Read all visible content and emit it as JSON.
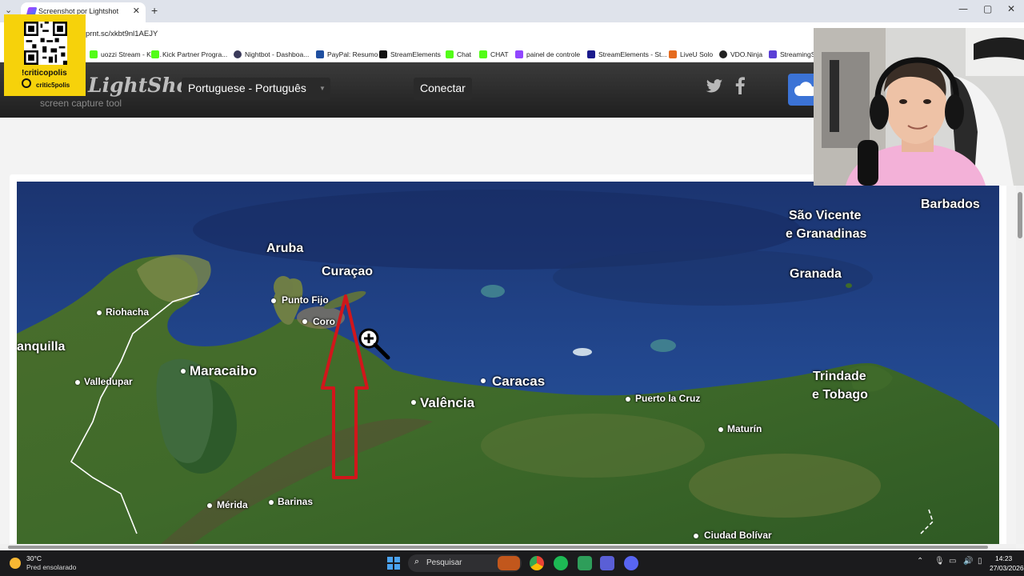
{
  "browser": {
    "tab_title": "Screenshot por Lightshot",
    "url": "prnt.sc/xkbt9nl1AEJY",
    "tab_close": "✕",
    "new_tab": "+",
    "window_controls": [
      "—",
      "▢",
      "✕"
    ],
    "bookmarks": [
      {
        "label": "uozzi Stream - Kic...",
        "icon": "kick-icon",
        "color": "#53fc18"
      },
      {
        "label": "Kick Partner Progra...",
        "icon": "kick-icon",
        "color": "#53fc18"
      },
      {
        "label": "Nightbot - Dashboa...",
        "icon": "nightbot-icon",
        "color": "#3a3a5a"
      },
      {
        "label": "PayPal: Resumo",
        "icon": "paypal-icon",
        "color": "#1f4fa0"
      },
      {
        "label": "StreamElements",
        "icon": "streamelements-icon",
        "color": "#111111"
      },
      {
        "label": "Chat",
        "icon": "kick-icon",
        "color": "#53fc18"
      },
      {
        "label": "CHAT",
        "icon": "kick-icon",
        "color": "#53fc18"
      },
      {
        "label": "painel de controle",
        "icon": "twitch-icon",
        "color": "#9146ff"
      },
      {
        "label": "StreamElements - St...",
        "icon": "streamelements-icon",
        "color": "#1a1a8c"
      },
      {
        "label": "LiveU Solo",
        "icon": "liveu-icon",
        "color": "#e56b1f"
      },
      {
        "label": "VDO.Ninja",
        "icon": "ninja-icon",
        "color": "#222222"
      },
      {
        "label": "StreamingS",
        "icon": "streaming-icon",
        "color": "#5a3fd6"
      }
    ]
  },
  "lightshot": {
    "logo": "LightShot",
    "tagline": "screen capture tool",
    "language": "Portuguese - Português",
    "connect": "Conectar",
    "twitter": "t",
    "facebook": "f"
  },
  "map": {
    "labels": {
      "aruba": "Aruba",
      "curacao": "Curaçao",
      "punto_fijo": "Punto Fijo",
      "coro": "Coro",
      "riohacha": "Riohacha",
      "barranquilla": "anquilla",
      "valledupar": "Valledupar",
      "maracaibo": "Maracaibo",
      "caracas": "Caracas",
      "valencia": "Valência",
      "puerto_la_cruz": "Puerto la Cruz",
      "maturin": "Maturín",
      "merida": "Mérida",
      "barinas": "Barinas",
      "ciudad_bolivar": "Ciudad Bolívar",
      "sao_vicente_1": "São Vicente",
      "sao_vicente_2": "e Granadinas",
      "granada": "Granada",
      "barbados": "Barbados",
      "trinidad_1": "Trindade",
      "trinidad_2": "e Tobago"
    },
    "arrow_color": "#d1161b"
  },
  "overlay": {
    "qr_handle": "!criticopolis",
    "qr_name": "critic5polis",
    "qr_bg": "#f6d20b"
  },
  "taskbar": {
    "temp": "30°C",
    "weather": "Pred ensolarado",
    "search": "Pesquisar",
    "time": "14:23",
    "date": "27/03/2026"
  }
}
